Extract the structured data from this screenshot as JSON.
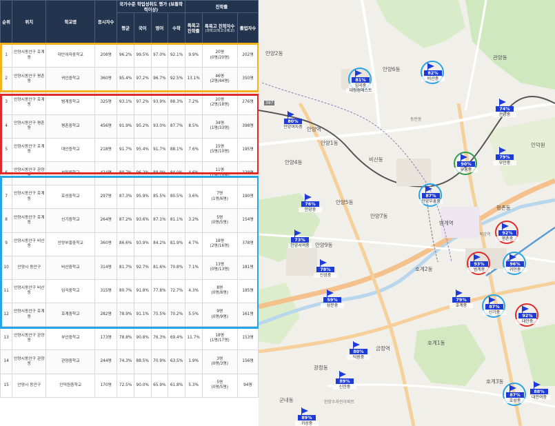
{
  "table": {
    "h_rank": "순위",
    "h_loc": "위치",
    "h_school": "학교명",
    "h_takers": "응시자수",
    "h_eval": "국가수준 학업성취도 평가 (보통학력이상)",
    "h_adv": "진학률",
    "h_avg": "평균",
    "h_kor": "국어",
    "h_eng": "영어",
    "h_math": "수학",
    "h_special": "특목고 진학률",
    "h_special_cnt": "특목고 진학자수",
    "h_special_cnt_sub": "(과학고/외고국제고)",
    "h_grads": "졸업자수",
    "rows": [
      {
        "rank": "1",
        "loc": "안양시동안구 호계동",
        "school": "대안여자중학교",
        "takers": "208명",
        "avg": "96.2%",
        "kor": "99.5%",
        "eng": "97.0%",
        "math": "92.1%",
        "special": "9.9%",
        "cnt": "20명",
        "cnt_sub": "(0명/20명)",
        "grads": "202명"
      },
      {
        "rank": "2",
        "loc": "안양시동안구 평촌동",
        "school": "귀인중학교",
        "takers": "360명",
        "avg": "95.4%",
        "kor": "97.2%",
        "eng": "96.7%",
        "math": "92.5%",
        "special": "13.1%",
        "cnt": "46명",
        "cnt_sub": "(2명/44명)",
        "grads": "350명"
      },
      {
        "rank": "3",
        "loc": "안양시동안구 호계동",
        "school": "범계중학교",
        "takers": "325명",
        "avg": "93.1%",
        "kor": "97.2%",
        "eng": "93.9%",
        "math": "88.3%",
        "special": "7.2%",
        "cnt": "20명",
        "cnt_sub": "(2명/18명)",
        "grads": "276명"
      },
      {
        "rank": "4",
        "loc": "안양시동안구 평촌동",
        "school": "평촌중학교",
        "takers": "456명",
        "avg": "91.9%",
        "kor": "95.2%",
        "eng": "93.0%",
        "math": "87.7%",
        "special": "8.5%",
        "cnt": "34명",
        "cnt_sub": "(1명/33명)",
        "grads": "398명"
      },
      {
        "rank": "5",
        "loc": "안양시동안구 호계동",
        "school": "대안중학교",
        "takers": "218명",
        "avg": "91.7%",
        "kor": "95.4%",
        "eng": "91.7%",
        "math": "88.1%",
        "special": "7.6%",
        "cnt": "15명",
        "cnt_sub": "(5명/10명)",
        "grads": "195명"
      },
      {
        "rank": "6",
        "loc": "안양시동안구 관양동",
        "school": "부림중학교",
        "takers": "424명",
        "avg": "89.7%",
        "kor": "96.2%",
        "eng": "88.9%",
        "math": "84.0%",
        "special": "4.6%",
        "cnt": "11명",
        "cnt_sub": "(1명/10명)",
        "grads": "238명"
      },
      {
        "rank": "7",
        "loc": "안양시동안구 호계동",
        "school": "호성중학교",
        "takers": "297명",
        "avg": "87.3%",
        "kor": "95.9%",
        "eng": "85.5%",
        "math": "80.5%",
        "special": "3.6%",
        "cnt": "7명",
        "cnt_sub": "(1명/6명)",
        "grads": "190명"
      },
      {
        "rank": "8",
        "loc": "안양시동안구 호계동",
        "school": "신기중학교",
        "takers": "264명",
        "avg": "87.2%",
        "kor": "93.6%",
        "eng": "87.1%",
        "math": "81.1%",
        "special": "3.2%",
        "cnt": "5명",
        "cnt_sub": "(0명/5명)",
        "grads": "154명"
      },
      {
        "rank": "9",
        "loc": "안양시동안구 비산동",
        "school": "안양부흥중학교",
        "takers": "360명",
        "avg": "86.6%",
        "kor": "93.9%",
        "eng": "84.2%",
        "math": "81.9%",
        "special": "4.7%",
        "cnt": "18명",
        "cnt_sub": "(2명/16명)",
        "grads": "378명"
      },
      {
        "rank": "10",
        "loc": "안양시 동안구",
        "school": "비산중학교",
        "takers": "314명",
        "avg": "81.7%",
        "kor": "92.7%",
        "eng": "81.6%",
        "math": "70.8%",
        "special": "7.1%",
        "cnt": "13명",
        "cnt_sub": "(0명/13명)",
        "grads": "181명"
      },
      {
        "rank": "11",
        "loc": "안양시동안구 비산동",
        "school": "임곡중학교",
        "takers": "315명",
        "avg": "80.7%",
        "kor": "91.8%",
        "eng": "77.8%",
        "math": "72.7%",
        "special": "4.3%",
        "cnt": "8명",
        "cnt_sub": "(0명/8명)",
        "grads": "185명"
      },
      {
        "rank": "12",
        "loc": "안양시동안구 호계동",
        "school": "호계중학교",
        "takers": "282명",
        "avg": "78.9%",
        "kor": "91.1%",
        "eng": "75.5%",
        "math": "70.2%",
        "special": "5.5%",
        "cnt": "9명",
        "cnt_sub": "(0명/9명)",
        "grads": "161명"
      },
      {
        "rank": "13",
        "loc": "안양시동안구 관양동",
        "school": "부안중학교",
        "takers": "173명",
        "avg": "78.8%",
        "kor": "90.8%",
        "eng": "76.3%",
        "math": "69.4%",
        "special": "11.7%",
        "cnt": "18명",
        "cnt_sub": "(1명/17명)",
        "grads": "153명"
      },
      {
        "rank": "14",
        "loc": "안양시동안구 관양동",
        "school": "관양중학교",
        "takers": "244명",
        "avg": "74.3%",
        "kor": "88.5%",
        "eng": "70.9%",
        "math": "63.5%",
        "special": "1.9%",
        "cnt": "3명",
        "cnt_sub": "(0명/3명)",
        "grads": "156명"
      },
      {
        "rank": "15",
        "loc": "안양시 동안구",
        "school": "인덕원중학교",
        "takers": "170명",
        "avg": "72.5%",
        "kor": "90.0%",
        "eng": "65.9%",
        "math": "61.8%",
        "special": "5.3%",
        "cnt": "5명",
        "cnt_sub": "(0명/5명)",
        "grads": "94명"
      }
    ]
  },
  "map": {
    "markers": [
      {
        "pct": "81%",
        "name": "임곡중",
        "name2": "대림점에스트"
      },
      {
        "pct": "82%",
        "name": "비산중"
      },
      {
        "pct": "74%",
        "name": "관양중"
      },
      {
        "pct": "80%",
        "name": "안양여자중"
      },
      {
        "pct": "90%",
        "name": "부흥중"
      },
      {
        "pct": "79%",
        "name": "부안중"
      },
      {
        "pct": "87%",
        "name": "안양부흥중"
      },
      {
        "pct": "76%",
        "name": "안양중"
      },
      {
        "pct": "92%",
        "name": "평촌중"
      },
      {
        "pct": "73%",
        "name": "안양서여중"
      },
      {
        "pct": "78%",
        "name": "신성중"
      },
      {
        "pct": "93%",
        "name": "범계중"
      },
      {
        "pct": "96%",
        "name": "귀인중"
      },
      {
        "pct": "59%",
        "name": "성문중"
      },
      {
        "pct": "79%",
        "name": "호계중"
      },
      {
        "pct": "87%",
        "name": "신기중"
      },
      {
        "pct": "92%",
        "name": "대안중"
      },
      {
        "pct": "80%",
        "name": "덕원중"
      },
      {
        "pct": "89%",
        "name": "신한중"
      },
      {
        "pct": "87%",
        "name": "호성중"
      },
      {
        "pct": "88%",
        "name": "대안여중"
      },
      {
        "pct": "89%",
        "name": "귀성중"
      }
    ],
    "labels": {
      "anyang2": "안양2동",
      "anyang1": "안양1동",
      "anyang4": "안양4동",
      "anyang5": "안양5동",
      "anyang6": "안양6동",
      "anyang7": "안양7동",
      "anyang9": "안양9동",
      "gwanyang": "관양동",
      "beomgye": "범계역",
      "pyeongchon": "평촌동",
      "inheokwon": "인덕원",
      "hogye2": "호계2동",
      "hogye1": "호계1동",
      "hogye3": "호계3동",
      "gundae": "군내동",
      "gwangjeong": "광정동",
      "geumjeong": "금정역",
      "anyangyeok": "안양역",
      "bisan": "비산동",
      "road397": "397",
      "dongan": "동안동",
      "apt": "한양수자인아파트",
      "mogam": "목감역"
    }
  },
  "colors": {
    "gold": "#f3b21b",
    "red": "#e02a2a",
    "blue": "#27a4e6",
    "header": "#23344f",
    "marker": "#1f3bd6"
  }
}
